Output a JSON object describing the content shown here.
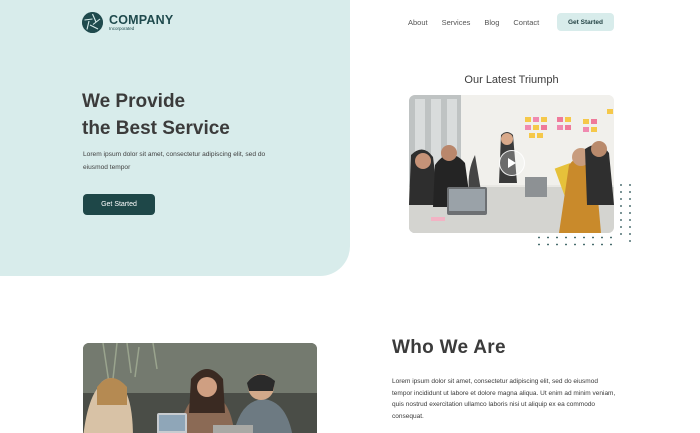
{
  "brand": {
    "name": "COMPANY",
    "tagline": "Incorporated",
    "accent": "#1f4a4d",
    "panel_color": "#d8eceb"
  },
  "nav": {
    "links": [
      "About",
      "Services",
      "Blog",
      "Contact"
    ],
    "cta": "Get Started"
  },
  "hero": {
    "title_line1": "We Provide",
    "title_line2": "the Best Service",
    "description": "Lorem ipsum dolor sit amet, consectetur adipiscing elit, sed do eiusmod tempor",
    "button": "Get Started"
  },
  "triumph": {
    "title": "Our Latest Triumph",
    "media_icon": "play-icon"
  },
  "who": {
    "title": "Who We Are",
    "description": "Lorem ipsum dolor sit amet, consectetur adipiscing elit, sed do eiusmod tempor incididunt ut labore et dolore magna aliqua. Ut enim ad minim veniam, quis nostrud exercitation ullamco laboris nisi ut aliquip ex ea commodo consequat."
  }
}
